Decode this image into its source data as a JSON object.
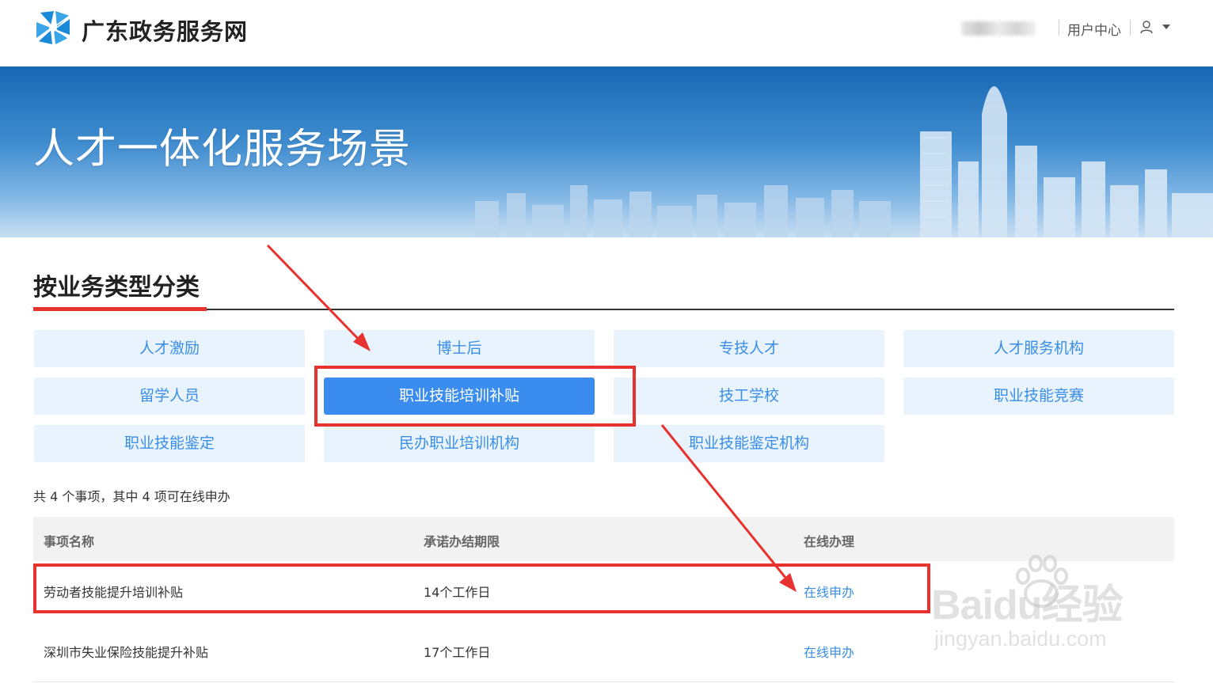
{
  "header": {
    "site_title": "广东政务服务网",
    "user_center": "用户中心"
  },
  "banner": {
    "title": "人才一体化服务场景"
  },
  "section": {
    "title": "按业务类型分类"
  },
  "categories": [
    {
      "label": "人才激励",
      "active": false
    },
    {
      "label": "博士后",
      "active": false
    },
    {
      "label": "专技人才",
      "active": false
    },
    {
      "label": "人才服务机构",
      "active": false
    },
    {
      "label": "留学人员",
      "active": false
    },
    {
      "label": "职业技能培训补贴",
      "active": true
    },
    {
      "label": "技工学校",
      "active": false
    },
    {
      "label": "职业技能竞赛",
      "active": false
    },
    {
      "label": "职业技能鉴定",
      "active": false
    },
    {
      "label": "民办职业培训机构",
      "active": false
    },
    {
      "label": "职业技能鉴定机构",
      "active": false
    }
  ],
  "summary": "共 4 个事项，其中 4 项可在线申办",
  "table": {
    "columns": [
      "事项名称",
      "承诺办结期限",
      "在线办理"
    ],
    "rows": [
      {
        "name": "劳动者技能提升培训补贴",
        "deadline": "14个工作日",
        "action": "在线申办"
      },
      {
        "name": "深圳市失业保险技能提升补贴",
        "deadline": "17个工作日",
        "action": "在线申办"
      }
    ]
  },
  "colors": {
    "accent": "#3b8cef",
    "button_bg": "#e9f3fd",
    "annotation_red": "#e8322f"
  },
  "watermark": {
    "main": "Baidu经验",
    "sub": "jingyan.baidu.com"
  }
}
